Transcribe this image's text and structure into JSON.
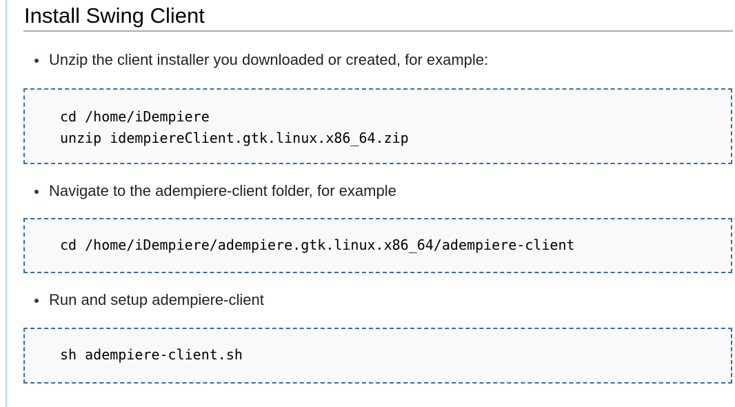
{
  "page": {
    "title": "Install Swing Client"
  },
  "steps": [
    {
      "text": "Unzip the client installer you downloaded or created, for example:",
      "code": [
        "cd /home/iDempiere",
        "unzip idempiereClient.gtk.linux.x86_64.zip"
      ]
    },
    {
      "text": "Navigate to the adempiere-client folder, for example",
      "code": [
        "cd /home/iDempiere/adempiere.gtk.linux.x86_64/adempiere-client"
      ]
    },
    {
      "text": "Run and setup adempiere-client",
      "code": [
        "sh adempiere-client.sh"
      ]
    }
  ],
  "colors": {
    "code_border": "#2f6fab",
    "code_background": "#f9f9f9",
    "title_rule": "#aaaaaa",
    "bullet": "#203a6a"
  }
}
